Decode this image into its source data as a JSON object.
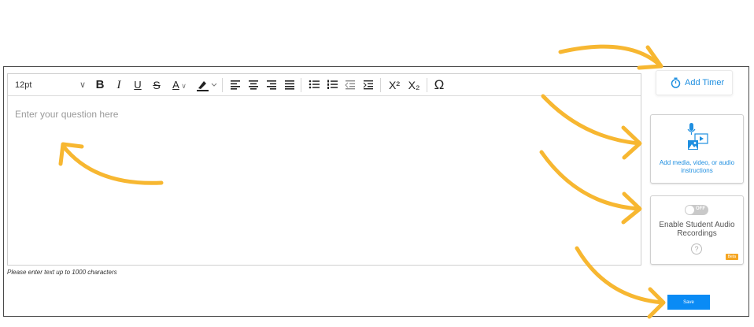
{
  "toolbar": {
    "font_size": "12pt",
    "buttons": [
      {
        "name": "bold-button",
        "glyph": "B"
      },
      {
        "name": "italic-button",
        "glyph": "I"
      },
      {
        "name": "underline-button",
        "glyph": "U"
      },
      {
        "name": "strikethrough-button",
        "glyph": "S"
      },
      {
        "name": "text-color-button",
        "glyph": "A"
      },
      {
        "name": "superscript-button",
        "glyph": "X²"
      },
      {
        "name": "subscript-button",
        "glyph": "X₂"
      },
      {
        "name": "special-character-button",
        "glyph": "Ω"
      }
    ]
  },
  "editor": {
    "placeholder": "Enter your question here",
    "hint": "Please enter text up to 1000 characters"
  },
  "sidebar": {
    "timer_label": "Add Timer",
    "media_label": "Add media, video, or audio instructions",
    "toggle_state": "OFF",
    "record_label": "Enable Student Audio Recordings",
    "help_glyph": "?",
    "beta_badge": "Beta"
  },
  "actions": {
    "save_label": "Save"
  },
  "colors": {
    "accent": "#1f8fe0",
    "save": "#0a8bf5",
    "arrow": "#f7b731",
    "badge": "#f5a623"
  }
}
